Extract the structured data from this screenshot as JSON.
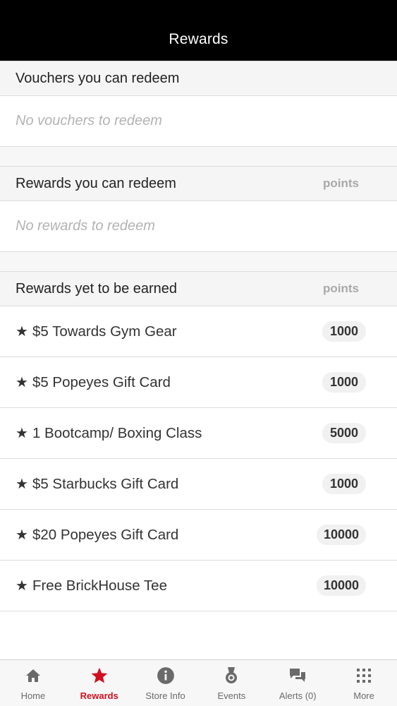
{
  "header": {
    "title": "Rewards"
  },
  "sections": {
    "vouchers": {
      "title": "Vouchers you can redeem",
      "empty_text": "No vouchers to redeem"
    },
    "redeemable": {
      "title": "Rewards you can redeem",
      "points_label": "points",
      "empty_text": "No rewards to redeem"
    },
    "yet_to_earn": {
      "title": "Rewards yet to be earned",
      "points_label": "points",
      "items": [
        {
          "star": "★",
          "name": "$5 Towards Gym Gear",
          "points": "1000"
        },
        {
          "star": "★",
          "name": "$5 Popeyes Gift Card",
          "points": "1000"
        },
        {
          "star": "★",
          "name": "1 Bootcamp/ Boxing Class",
          "points": "5000"
        },
        {
          "star": "★",
          "name": "$5 Starbucks Gift Card",
          "points": "1000"
        },
        {
          "star": "★",
          "name": "$20 Popeyes Gift Card",
          "points": "10000"
        },
        {
          "star": "★",
          "name": "Free BrickHouse Tee",
          "points": "10000"
        }
      ]
    }
  },
  "tabbar": {
    "tabs": [
      {
        "label": "Home",
        "icon": "home-icon",
        "active": false
      },
      {
        "label": "Rewards",
        "icon": "star-icon",
        "active": true
      },
      {
        "label": "Store Info",
        "icon": "info-icon",
        "active": false
      },
      {
        "label": "Events",
        "icon": "medal-icon",
        "active": false
      },
      {
        "label": "Alerts (0)",
        "icon": "chat-bubbles-icon",
        "active": false
      },
      {
        "label": "More",
        "icon": "grid-icon",
        "active": false
      }
    ]
  },
  "colors": {
    "accent": "#d10f1f",
    "header_bg": "#000000",
    "inactive": "#6a6a6a"
  }
}
